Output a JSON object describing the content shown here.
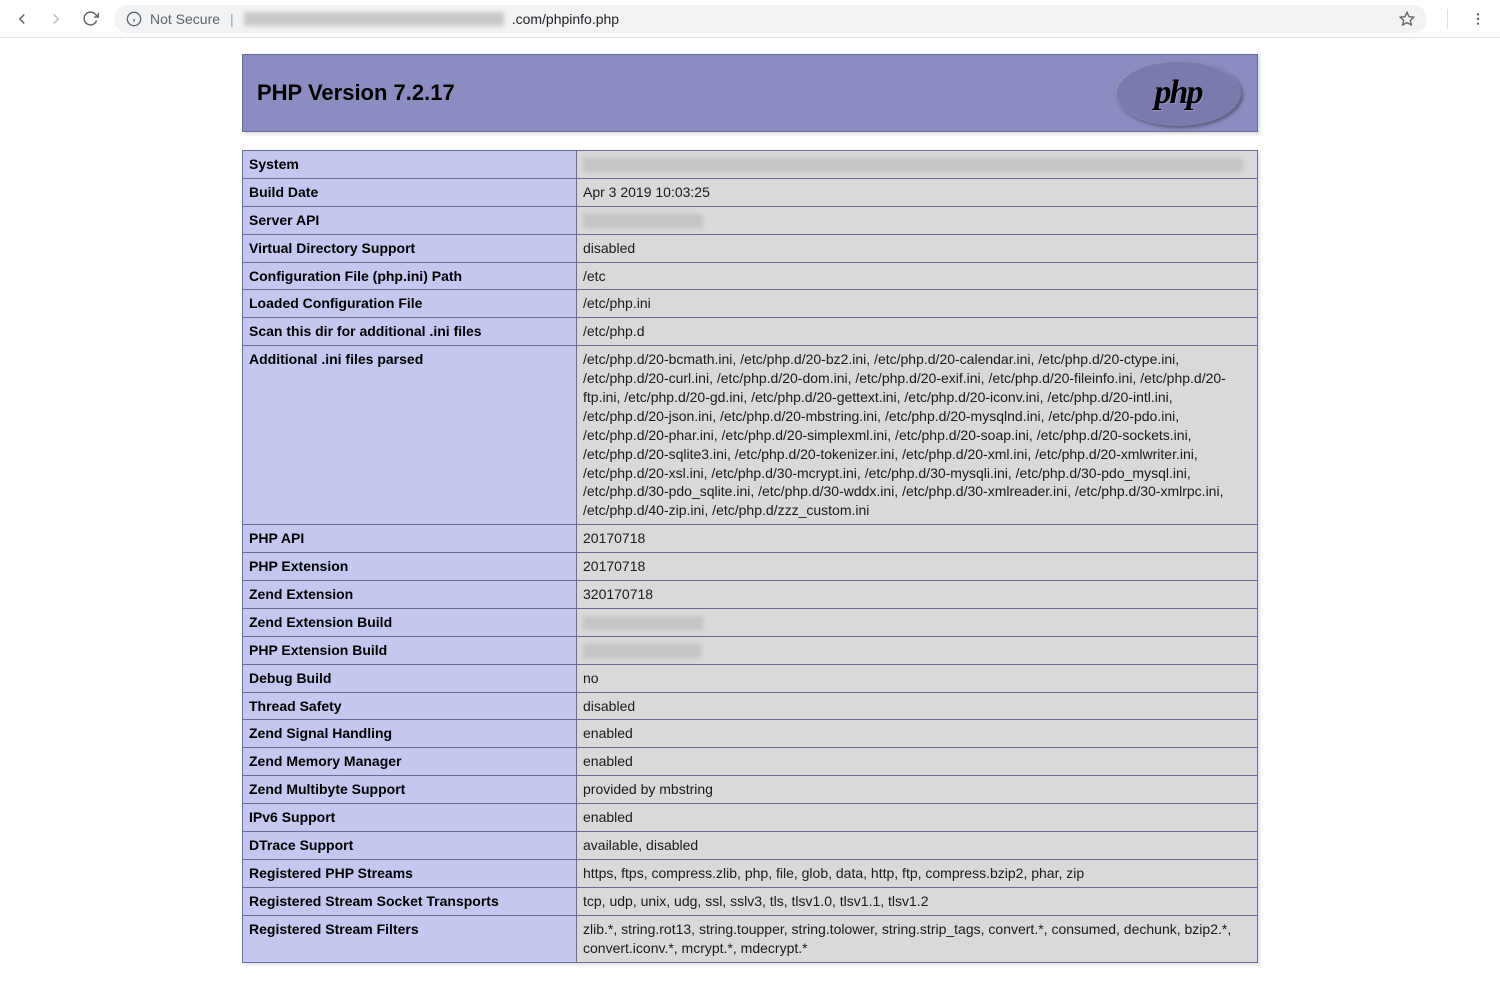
{
  "browser": {
    "not_secure_label": "Not Secure",
    "url_suffix": ".com/phpinfo.php"
  },
  "header": {
    "title": "PHP Version 7.2.17",
    "logo_text": "php"
  },
  "info_rows": [
    {
      "key": "System",
      "value": "",
      "blurred": true,
      "blur_width": 660
    },
    {
      "key": "Build Date",
      "value": "Apr 3 2019 10:03:25"
    },
    {
      "key": "Server API",
      "value": "",
      "blurred": true,
      "blur_width": 120
    },
    {
      "key": "Virtual Directory Support",
      "value": "disabled"
    },
    {
      "key": "Configuration File (php.ini) Path",
      "value": "/etc"
    },
    {
      "key": "Loaded Configuration File",
      "value": "/etc/php.ini"
    },
    {
      "key": "Scan this dir for additional .ini files",
      "value": "/etc/php.d"
    },
    {
      "key": "Additional .ini files parsed",
      "value": "/etc/php.d/20-bcmath.ini, /etc/php.d/20-bz2.ini, /etc/php.d/20-calendar.ini, /etc/php.d/20-ctype.ini, /etc/php.d/20-curl.ini, /etc/php.d/20-dom.ini, /etc/php.d/20-exif.ini, /etc/php.d/20-fileinfo.ini, /etc/php.d/20-ftp.ini, /etc/php.d/20-gd.ini, /etc/php.d/20-gettext.ini, /etc/php.d/20-iconv.ini, /etc/php.d/20-intl.ini, /etc/php.d/20-json.ini, /etc/php.d/20-mbstring.ini, /etc/php.d/20-mysqlnd.ini, /etc/php.d/20-pdo.ini, /etc/php.d/20-phar.ini, /etc/php.d/20-simplexml.ini, /etc/php.d/20-soap.ini, /etc/php.d/20-sockets.ini, /etc/php.d/20-sqlite3.ini, /etc/php.d/20-tokenizer.ini, /etc/php.d/20-xml.ini, /etc/php.d/20-xmlwriter.ini, /etc/php.d/20-xsl.ini, /etc/php.d/30-mcrypt.ini, /etc/php.d/30-mysqli.ini, /etc/php.d/30-pdo_mysql.ini, /etc/php.d/30-pdo_sqlite.ini, /etc/php.d/30-wddx.ini, /etc/php.d/30-xmlreader.ini, /etc/php.d/30-xmlrpc.ini, /etc/php.d/40-zip.ini, /etc/php.d/zzz_custom.ini"
    },
    {
      "key": "PHP API",
      "value": "20170718"
    },
    {
      "key": "PHP Extension",
      "value": "20170718"
    },
    {
      "key": "Zend Extension",
      "value": "320170718"
    },
    {
      "key": "Zend Extension Build",
      "value": "",
      "blurred": true,
      "blur_width": 120
    },
    {
      "key": "PHP Extension Build",
      "value": "",
      "blurred": true,
      "blur_width": 118
    },
    {
      "key": "Debug Build",
      "value": "no"
    },
    {
      "key": "Thread Safety",
      "value": "disabled"
    },
    {
      "key": "Zend Signal Handling",
      "value": "enabled"
    },
    {
      "key": "Zend Memory Manager",
      "value": "enabled"
    },
    {
      "key": "Zend Multibyte Support",
      "value": "provided by mbstring"
    },
    {
      "key": "IPv6 Support",
      "value": "enabled"
    },
    {
      "key": "DTrace Support",
      "value": "available, disabled"
    },
    {
      "key": "Registered PHP Streams",
      "value": "https, ftps, compress.zlib, php, file, glob, data, http, ftp, compress.bzip2, phar, zip"
    },
    {
      "key": "Registered Stream Socket Transports",
      "value": "tcp, udp, unix, udg, ssl, sslv3, tls, tlsv1.0, tlsv1.1, tlsv1.2"
    },
    {
      "key": "Registered Stream Filters",
      "value": "zlib.*, string.rot13, string.toupper, string.tolower, string.strip_tags, convert.*, consumed, dechunk, bzip2.*, convert.iconv.*, mcrypt.*, mdecrypt.*"
    }
  ]
}
